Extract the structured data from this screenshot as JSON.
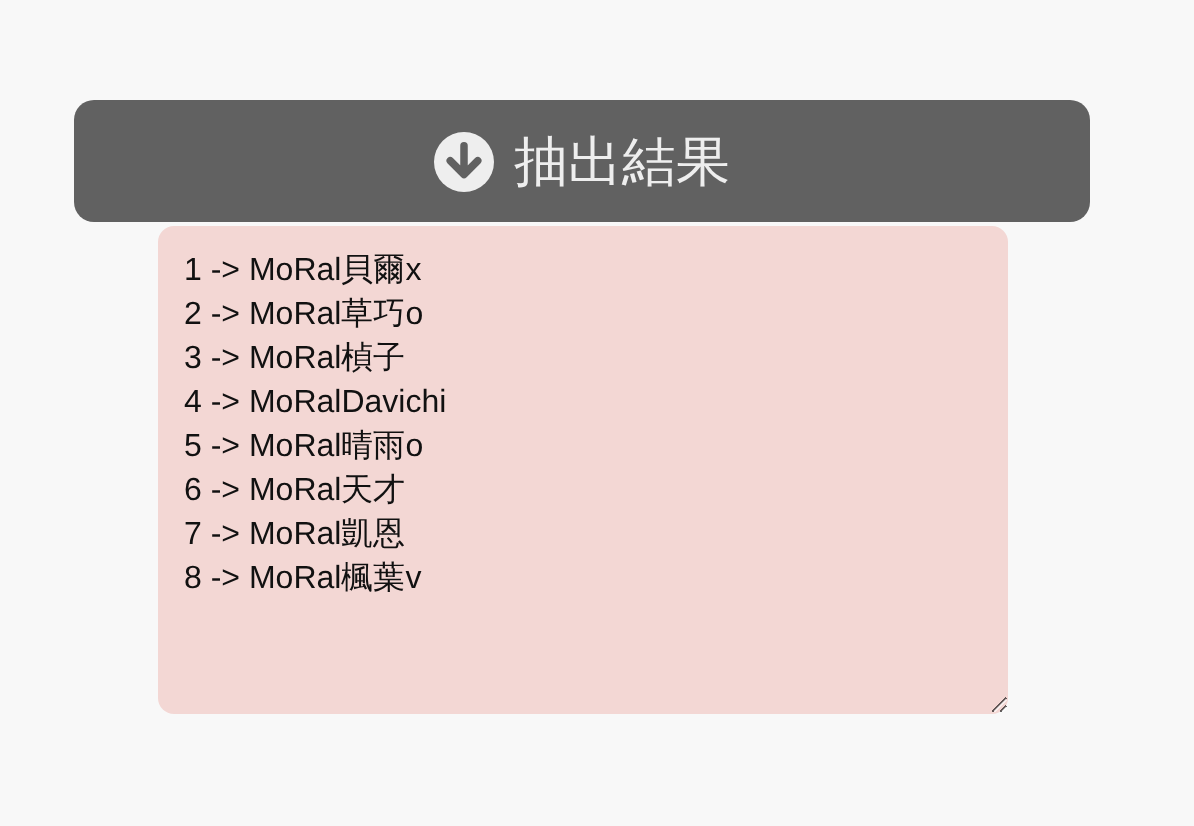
{
  "draw_button": {
    "label": "抽出結果"
  },
  "results": [
    "1 -> MoRal貝爾x",
    "2 -> MoRal草巧o",
    "3 -> MoRal楨子",
    "4 -> MoRalDavichi",
    "5 -> MoRal晴雨o",
    "6 -> MoRal天才",
    "7 -> MoRal凱恩",
    "8 -> MoRal楓葉v"
  ]
}
